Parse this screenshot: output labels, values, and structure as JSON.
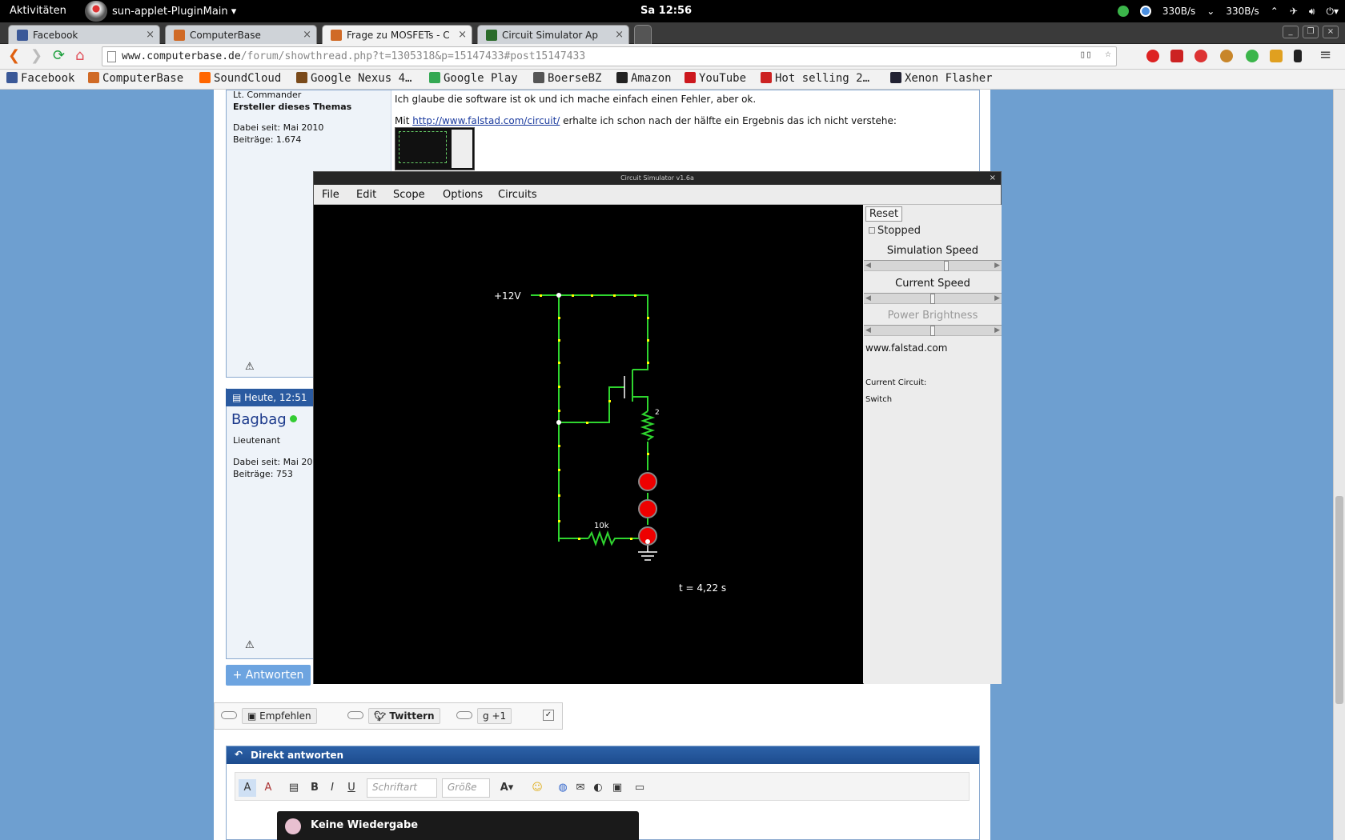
{
  "topbar": {
    "activities": "Aktivitäten",
    "app_name": "sun-applet-PluginMain ▾",
    "clock": "Sa 12:56",
    "net_down": "330B/s",
    "net_up": "330B/s"
  },
  "tabs": [
    {
      "label": "Facebook",
      "color": "#3b5998"
    },
    {
      "label": "ComputerBase",
      "color": "#d06a26"
    },
    {
      "label": "Frage zu MOSFETs - C",
      "color": "#d06a26"
    },
    {
      "label": "Circuit Simulator Ap",
      "color": "#2a6b2a"
    }
  ],
  "address": {
    "host": "www.computerbase.de",
    "path": "/forum/showthread.php?t=1305318&p=15147433#post15147433"
  },
  "bookmarks": [
    {
      "label": "Facebook",
      "color": "#3b5998"
    },
    {
      "label": "ComputerBase",
      "color": "#d06a26"
    },
    {
      "label": "SoundCloud",
      "color": "#f60"
    },
    {
      "label": "Google Nexus 4…",
      "color": "#7a4a1a"
    },
    {
      "label": "Google Play",
      "color": "#34a853"
    },
    {
      "label": "BoerseBZ",
      "color": "#555"
    },
    {
      "label": "Amazon",
      "color": "#222"
    },
    {
      "label": "YouTube",
      "color": "#cc181e"
    },
    {
      "label": "Hot selling 2…",
      "color": "#c22"
    },
    {
      "label": "Xenon Flasher",
      "color": "#223"
    }
  ],
  "post1": {
    "rank": "Lt. Commander",
    "role": "Ersteller dieses Themas",
    "joined": "Dabei seit: Mai 2010",
    "posts": "Beiträge: 1.674",
    "text1": "Ich glaube die software ist ok und ich mache einfach einen Fehler, aber ok.",
    "text2_pre": "Mit ",
    "link": "http://www.falstad.com/circuit/",
    "text2_post": " erhalte ich schon nach der hälfte ein Ergebnis das ich nicht verstehe:"
  },
  "post2": {
    "date": "Heute, 12:51",
    "user": "Bagbag",
    "rank": "Lieutenant",
    "joined": "Dabei seit: Mai 20",
    "posts": "Beiträge: 753"
  },
  "reply_button": "+ Antworten",
  "social": {
    "fb": "Empfehlen",
    "tw": "Twittern",
    "gp": "+1"
  },
  "direkt": {
    "header": "Direkt antworten",
    "font_placeholder": "Schriftart",
    "size_placeholder": "Größe"
  },
  "media_popup": "Keine Wiedergabe",
  "simulator": {
    "window_title": "Circuit Simulator v1.6a",
    "menu": [
      "File",
      "Edit",
      "Scope",
      "Options",
      "Circuits"
    ],
    "reset": "Reset",
    "stopped": "Stopped",
    "sim_speed": "Simulation Speed",
    "current_speed": "Current Speed",
    "power_brightness": "Power Brightness",
    "site": "www.falstad.com",
    "current_circuit_label": "Current Circuit:",
    "current_circuit": "Switch",
    "voltage_label": "+12V",
    "resistor1_label": "2",
    "resistor2_label": "10k",
    "time": "t = 4,22 s",
    "sim_speed_level": 0.62,
    "current_speed_level": 0.5,
    "power_brightness_level": 0.5
  }
}
